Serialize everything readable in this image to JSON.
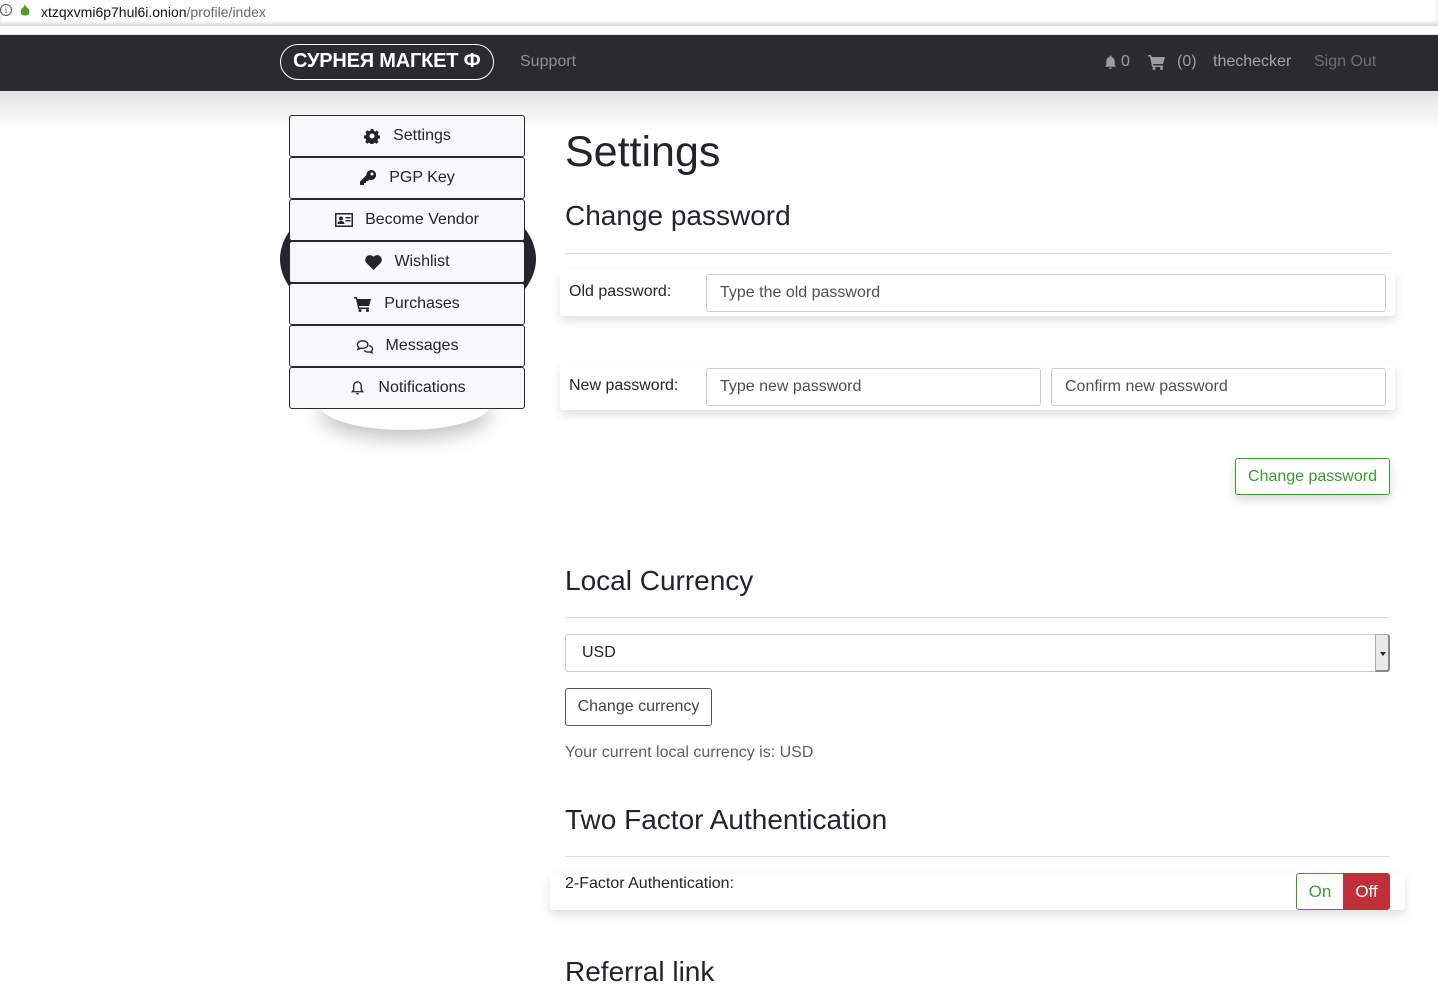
{
  "browser": {
    "url_host": "xtzqxvmi6p7hul6i.onion",
    "url_path": "/profile/index",
    "info_icon": "info-icon",
    "site_icon": "onion-icon"
  },
  "navbar": {
    "brand": "СУРНЕЯ МАГКЕТ Ф",
    "support": "Support",
    "notifications_count": "0",
    "cart_count": "(0)",
    "username": "thechecker",
    "sign_out": "Sign Out",
    "icons": [
      "bell-icon",
      "cart-icon"
    ]
  },
  "sidebar": {
    "items": [
      {
        "label": "Settings",
        "icon": "gear-icon"
      },
      {
        "label": "PGP Key",
        "icon": "key-icon"
      },
      {
        "label": "Become Vendor",
        "icon": "id-card-icon"
      },
      {
        "label": "Wishlist",
        "icon": "heart-icon"
      },
      {
        "label": "Purchases",
        "icon": "cart-icon"
      },
      {
        "label": "Messages",
        "icon": "comments-icon"
      },
      {
        "label": "Notifications",
        "icon": "bell-icon"
      }
    ]
  },
  "main": {
    "title": "Settings",
    "change_password": {
      "heading": "Change password",
      "old_label": "Old password:",
      "old_placeholder": "Type the old password",
      "new_label": "New password:",
      "new_placeholder": "Type new password",
      "confirm_placeholder": "Confirm new password",
      "submit": "Change password"
    },
    "currency": {
      "heading": "Local Currency",
      "selected": "USD",
      "submit": "Change currency",
      "status": "Your current local currency is: USD"
    },
    "two_factor": {
      "heading": "Two Factor Authentication",
      "label": "2-Factor Authentication:",
      "on": "On",
      "off": "Off",
      "state": "Off"
    },
    "referral": {
      "heading": "Referral link"
    }
  },
  "colors": {
    "navbar_bg": "#292b2f",
    "success": "#3a9a30",
    "danger": "#c0303b"
  }
}
